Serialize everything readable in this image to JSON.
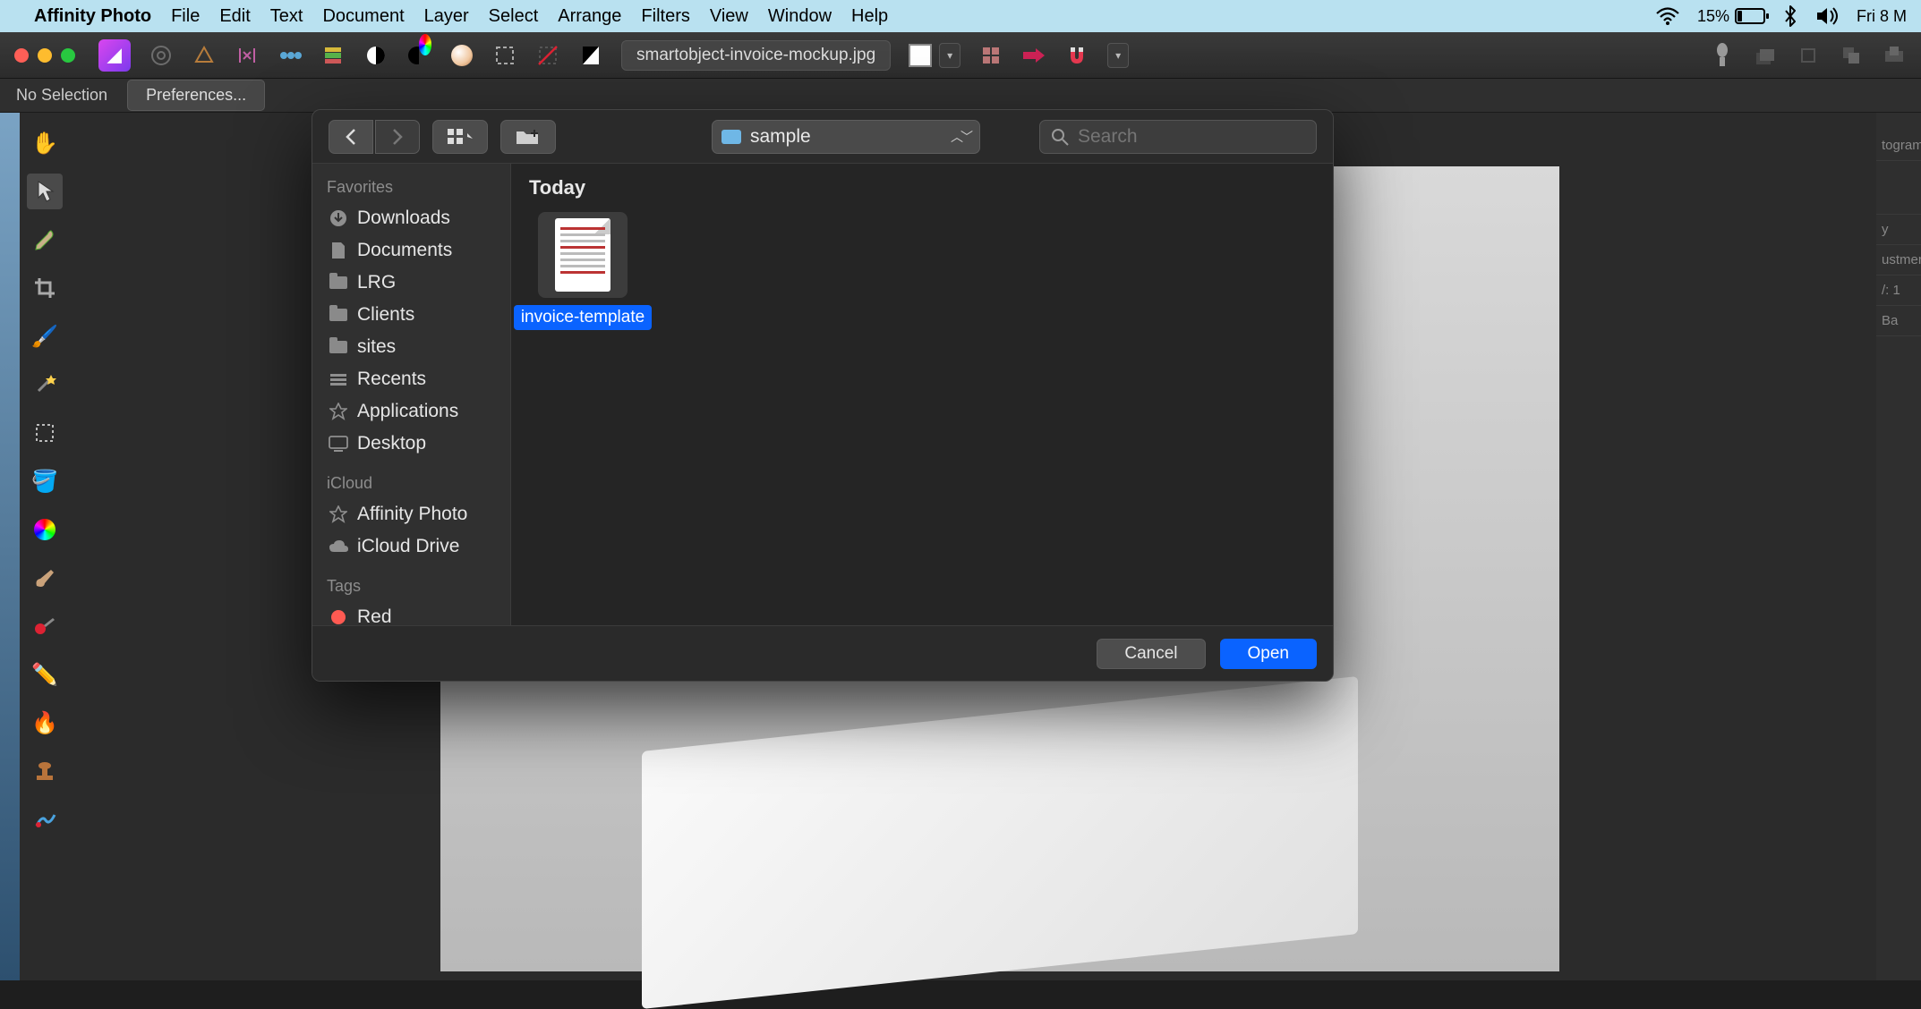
{
  "menubar": {
    "app": "Affinity Photo",
    "items": [
      "File",
      "Edit",
      "Text",
      "Document",
      "Layer",
      "Select",
      "Arrange",
      "Filters",
      "View",
      "Window",
      "Help"
    ],
    "battery_pct": "15%",
    "clock": "Fri 8 M"
  },
  "toolbar": {
    "doc_title": "smartobject-invoice-mockup.jpg"
  },
  "context_bar": {
    "status": "No Selection",
    "prefs": "Preferences..."
  },
  "right_panels": {
    "p1": "togram",
    "p2": "y",
    "p3": "ustmer",
    "p4": "/: 1",
    "p5": "Ba"
  },
  "modal": {
    "location": "sample",
    "search_placeholder": "Search",
    "section": "Today",
    "sidebar": {
      "favorites_head": "Favorites",
      "items": [
        "Downloads",
        "Documents",
        "LRG",
        "Clients",
        "sites",
        "Recents",
        "Applications",
        "Desktop"
      ],
      "icloud_head": "iCloud",
      "icloud_items": [
        "Affinity Photo",
        "iCloud Drive"
      ],
      "tags_head": "Tags",
      "tags": [
        {
          "name": "Red",
          "color": "#ff5a52"
        }
      ]
    },
    "files": [
      {
        "name": "invoice-template",
        "selected": true
      }
    ],
    "buttons": {
      "cancel": "Cancel",
      "open": "Open"
    }
  }
}
